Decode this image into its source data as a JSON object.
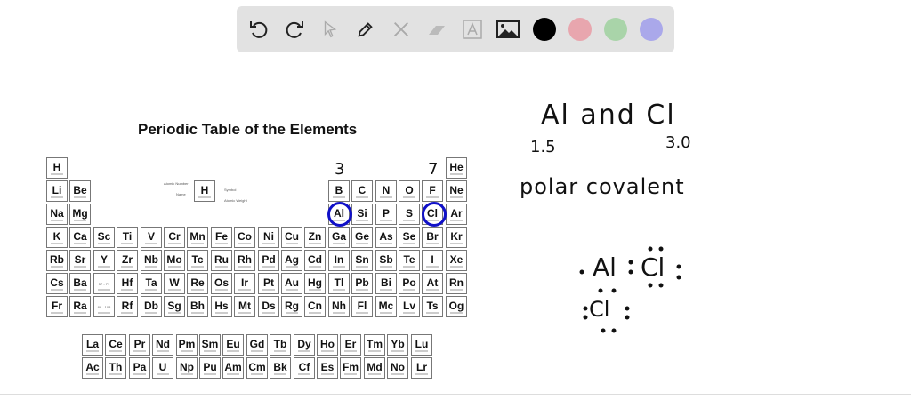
{
  "toolbar": {
    "tools": [
      "undo-icon",
      "redo-icon",
      "select-icon",
      "pen-icon",
      "tools-icon",
      "eraser-icon",
      "text-icon",
      "image-icon"
    ],
    "colors": [
      "#000000",
      "#e8a6ae",
      "#a9d4a9",
      "#aaa8ea"
    ]
  },
  "table": {
    "title": "Periodic Table of the Elements",
    "rows": [
      [
        "H",
        "",
        "",
        "",
        "",
        "",
        "",
        "",
        "",
        "",
        "",
        "",
        "",
        "",
        "",
        "",
        "",
        "He"
      ],
      [
        "Li",
        "Be",
        "",
        "",
        "",
        "",
        "",
        "",
        "",
        "",
        "",
        "",
        "B",
        "C",
        "N",
        "O",
        "F",
        "Ne"
      ],
      [
        "Na",
        "Mg",
        "",
        "",
        "",
        "",
        "",
        "",
        "",
        "",
        "",
        "",
        "Al",
        "Si",
        "P",
        "S",
        "Cl",
        "Ar"
      ],
      [
        "K",
        "Ca",
        "Sc",
        "Ti",
        "V",
        "Cr",
        "Mn",
        "Fe",
        "Co",
        "Ni",
        "Cu",
        "Zn",
        "Ga",
        "Ge",
        "As",
        "Se",
        "Br",
        "Kr"
      ],
      [
        "Rb",
        "Sr",
        "Y",
        "Zr",
        "Nb",
        "Mo",
        "Tc",
        "Ru",
        "Rh",
        "Pd",
        "Ag",
        "Cd",
        "In",
        "Sn",
        "Sb",
        "Te",
        "I",
        "Xe"
      ],
      [
        "Cs",
        "Ba",
        "57 - 71",
        "Hf",
        "Ta",
        "W",
        "Re",
        "Os",
        "Ir",
        "Pt",
        "Au",
        "Hg",
        "Tl",
        "Pb",
        "Bi",
        "Po",
        "At",
        "Rn"
      ],
      [
        "Fr",
        "Ra",
        "89 - 103",
        "Rf",
        "Db",
        "Sg",
        "Bh",
        "Hs",
        "Mt",
        "Ds",
        "Rg",
        "Cn",
        "Nh",
        "Fl",
        "Mc",
        "Lv",
        "Ts",
        "Og"
      ]
    ],
    "lanthanides": [
      "La",
      "Ce",
      "Pr",
      "Nd",
      "Pm",
      "Sm",
      "Eu",
      "Gd",
      "Tb",
      "Dy",
      "Ho",
      "Er",
      "Tm",
      "Yb",
      "Lu"
    ],
    "actinides": [
      "Ac",
      "Th",
      "Pa",
      "U",
      "Np",
      "Pu",
      "Am",
      "Cm",
      "Bk",
      "Cf",
      "Es",
      "Fm",
      "Md",
      "No",
      "Lr"
    ],
    "legend": {
      "symbol": "H",
      "atomic_number": "Atomic Number",
      "name": "Name",
      "symbol_label": "Symbol",
      "atomic_weight": "Atomic Weight"
    }
  },
  "annotations": {
    "al_valence": "3",
    "cl_valence": "7",
    "pair": "Al and Cl",
    "al_en": "1.5",
    "cl_en": "3.0",
    "bond_type": "polar covalent",
    "lewis_al": "Al",
    "lewis_cl1": "Cl",
    "lewis_cl2": "Cl"
  }
}
